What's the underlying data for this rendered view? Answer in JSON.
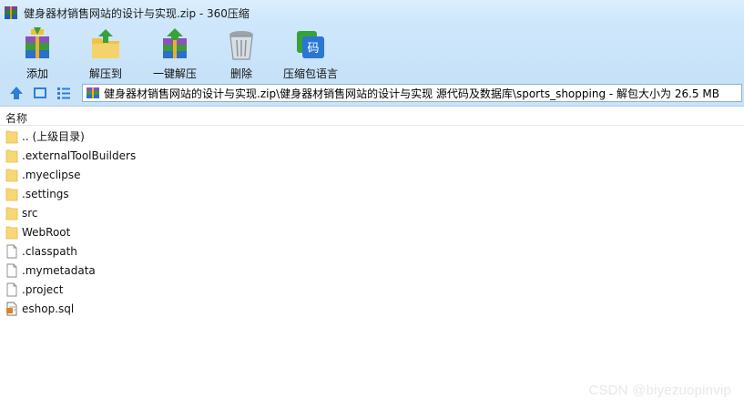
{
  "window": {
    "title": "健身器材销售网站的设计与实现.zip - 360压缩"
  },
  "toolbar": {
    "buttons": [
      {
        "label": "添加",
        "icon": "add-archive-icon"
      },
      {
        "label": "解压到",
        "icon": "extract-to-icon"
      },
      {
        "label": "一键解压",
        "icon": "one-click-extract-icon"
      },
      {
        "label": "删除",
        "icon": "trash-icon"
      },
      {
        "label": "压缩包语言",
        "icon": "archive-language-icon"
      }
    ]
  },
  "address": {
    "path": "健身器材销售网站的设计与实现.zip\\健身器材销售网站的设计与实现 源代码及数据库\\sports_shopping - 解包大小为 26.5 MB"
  },
  "list": {
    "column_name": "名称",
    "items": [
      {
        "name": ".. (上级目录)",
        "type": "folder"
      },
      {
        "name": ".externalToolBuilders",
        "type": "folder"
      },
      {
        "name": ".myeclipse",
        "type": "folder"
      },
      {
        "name": ".settings",
        "type": "folder"
      },
      {
        "name": "src",
        "type": "folder"
      },
      {
        "name": "WebRoot",
        "type": "folder"
      },
      {
        "name": ".classpath",
        "type": "file"
      },
      {
        "name": ".mymetadata",
        "type": "file"
      },
      {
        "name": ".project",
        "type": "file"
      },
      {
        "name": "eshop.sql",
        "type": "sql-file"
      }
    ]
  },
  "watermark": "CSDN @biyezuopinvip",
  "colors": {
    "toolbar_bg": "#cfe7fb",
    "folder": "#f8d775",
    "address_border": "#8fb0cc"
  }
}
